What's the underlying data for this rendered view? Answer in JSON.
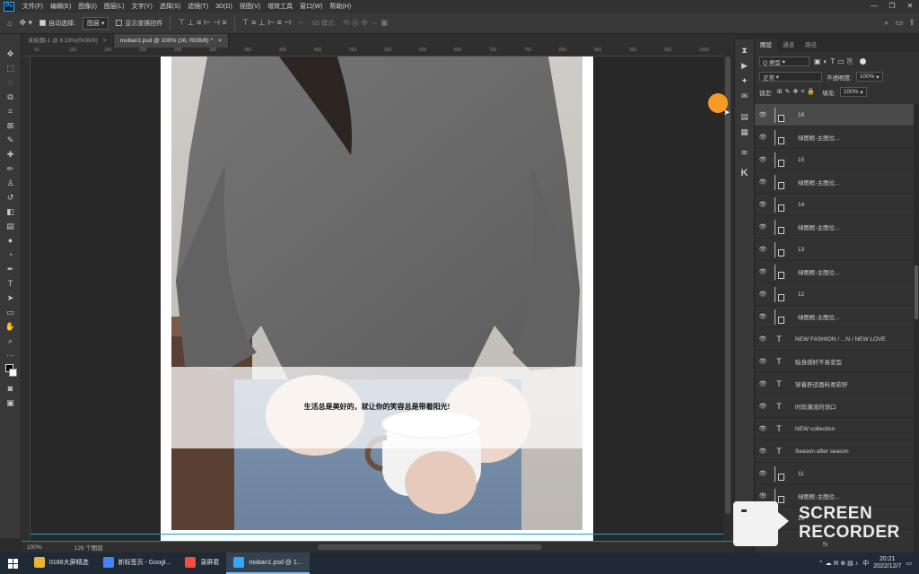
{
  "menubar": {
    "logo": "Ps",
    "items": [
      "文件(F)",
      "编辑(E)",
      "图像(I)",
      "图层(L)",
      "文字(Y)",
      "选择(S)",
      "滤镜(T)",
      "3D(D)",
      "视图(V)",
      "增效工具",
      "窗口(W)",
      "帮助(H)"
    ],
    "window_controls": [
      "—",
      "❐",
      "✕"
    ]
  },
  "options": {
    "auto_select_label": "自动选择:",
    "auto_select_value": "图层",
    "show_transform_label": "显示变换控件",
    "mode_3d_label": "3D 模式:",
    "more_label": "···"
  },
  "tabs": [
    {
      "label": "未标题-1 @ 8.33%(RGB/8)",
      "close": "×",
      "active": false
    },
    {
      "label": "moban1.psd @ 100% (16, RGB/8) *",
      "close": "×",
      "active": true
    }
  ],
  "ruler": {
    "ticks": [
      "50",
      "100",
      "150",
      "200",
      "250",
      "300",
      "350",
      "400",
      "450",
      "500",
      "550",
      "600",
      "650",
      "700",
      "750",
      "800",
      "850",
      "900",
      "950",
      "1000"
    ]
  },
  "canvas": {
    "caption": "生活总是美好的，就让你的笑容总是带着阳光!"
  },
  "status": {
    "zoom": "100%",
    "layers_count": "126 个图层"
  },
  "layers_panel": {
    "tabs": [
      "图层",
      "通道",
      "路径"
    ],
    "filter_label": "Q 类型",
    "blend_mode": "正常",
    "opacity_label": "不透明度:",
    "opacity_value": "100%",
    "lock_label": "锁定:",
    "fill_label": "填充:",
    "fill_value": "100%",
    "layers": [
      {
        "name": "16",
        "kind": "group",
        "selected": true
      },
      {
        "name": "绿图框-主图位...",
        "kind": "frame",
        "selected": false
      },
      {
        "name": "15",
        "kind": "group",
        "selected": false
      },
      {
        "name": "绿图框-主图位...",
        "kind": "frame",
        "selected": false
      },
      {
        "name": "14",
        "kind": "group",
        "selected": false
      },
      {
        "name": "绿图框-主图位...",
        "kind": "frame",
        "selected": false
      },
      {
        "name": "13",
        "kind": "group",
        "selected": false
      },
      {
        "name": "绿图框-主图位...",
        "kind": "frame",
        "selected": false
      },
      {
        "name": "12",
        "kind": "group",
        "selected": false
      },
      {
        "name": "绿图框-主图位...",
        "kind": "frame",
        "selected": false
      },
      {
        "name": "NEW FASHION  /  ...N  /  NEW LOVE",
        "kind": "text",
        "selected": false
      },
      {
        "name": "贴身感好不易变型",
        "kind": "text",
        "selected": false
      },
      {
        "name": "穿着舒适面料柔软好",
        "kind": "text",
        "selected": false
      },
      {
        "name": "时尚潮流的领口",
        "kind": "text",
        "selected": false
      },
      {
        "name": "NEW collection",
        "kind": "text",
        "selected": false
      },
      {
        "name": "Season after season",
        "kind": "text",
        "selected": false
      },
      {
        "name": "11",
        "kind": "group",
        "selected": false
      },
      {
        "name": "绿图框-主图位...",
        "kind": "frame",
        "selected": false
      },
      {
        "name": "10",
        "kind": "group",
        "selected": false
      }
    ],
    "footer": "fx"
  },
  "taskbar": {
    "items": [
      {
        "label": "0188大屏精选",
        "color": "#e8b339"
      },
      {
        "label": "新标签页 - Googl...",
        "color": "#4285f4"
      },
      {
        "label": "录屏君",
        "color": "#f24e3b"
      },
      {
        "label": "moban1.psd @ 1...",
        "color": "#31a8ff",
        "active": true
      }
    ],
    "tray_lang": "中",
    "time": "20:21",
    "date": "2022/12/7"
  },
  "watermark": {
    "line1": "SCREEN",
    "line2": "RECORDER"
  }
}
